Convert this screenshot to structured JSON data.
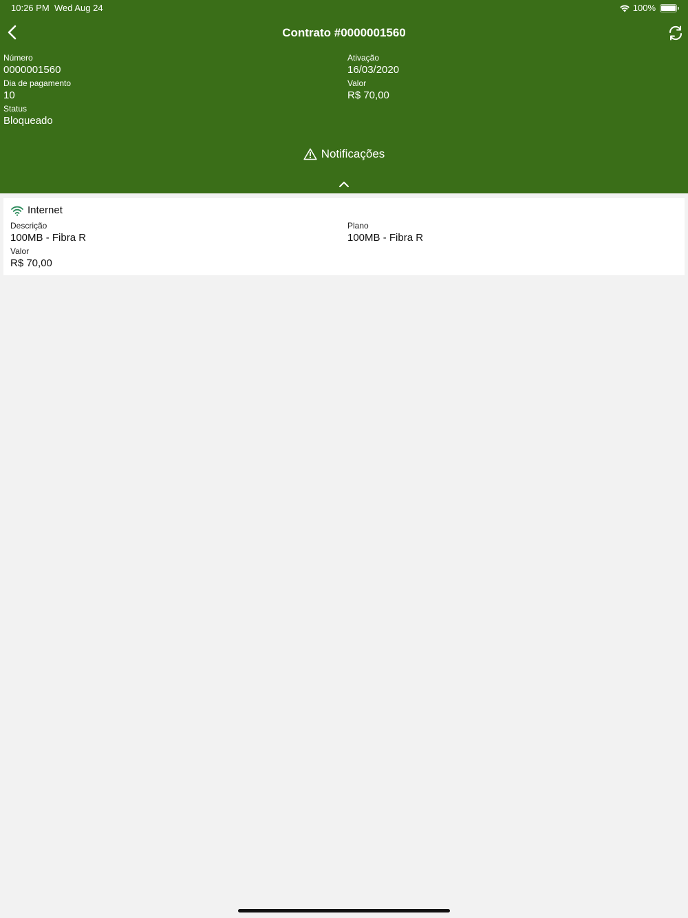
{
  "status_bar": {
    "time": "10:26 PM",
    "date": "Wed Aug 24",
    "battery": "100%",
    "battery_level": 1.0
  },
  "header": {
    "title": "Contrato #0000001560",
    "back_icon": "chevron-left-icon",
    "refresh_icon": "refresh-icon",
    "background_color": "#3a6e18"
  },
  "contract": {
    "numero_label": "Número",
    "numero": "0000001560",
    "ativacao_label": "Ativação",
    "ativacao": "16/03/2020",
    "dia_label": "Dia de pagamento",
    "dia": "10",
    "valor_label": "Valor",
    "valor": "R$ 70,00",
    "status_label": "Status",
    "status": "Bloqueado"
  },
  "notifications": {
    "label": "Notificações",
    "icon": "warning-icon",
    "toggle_icon": "chevron-up-icon"
  },
  "service": {
    "title": "Internet",
    "icon": "wifi-icon",
    "icon_color": "#2a8a5a",
    "descricao_label": "Descrição",
    "descricao": "100MB - Fibra R",
    "plano_label": "Plano",
    "plano": "100MB - Fibra R",
    "valor_label": "Valor",
    "valor": "R$ 70,00"
  }
}
